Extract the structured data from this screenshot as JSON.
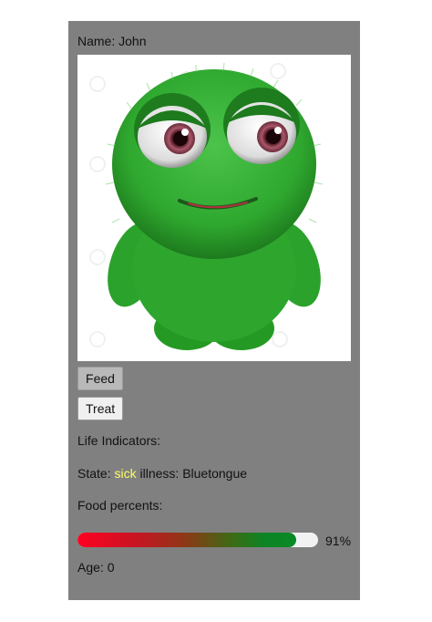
{
  "pet": {
    "name_label": "Name:",
    "name": "John",
    "image_alt": "green furry monster"
  },
  "actions": {
    "feed_label": "Feed",
    "treat_label": "Treat"
  },
  "life": {
    "indicators_label": "Life Indicators:",
    "state_label": "State:",
    "state_value": "sick",
    "illness_label": "illness:",
    "illness_value": "Bluetongue",
    "state_value_color": "#ffff66"
  },
  "food": {
    "label": "Food percents:",
    "percent": 91,
    "percent_text": "91%"
  },
  "age": {
    "label": "Age:",
    "value": "0"
  },
  "colors": {
    "card_background": "#808080",
    "page_background": "#ffffff",
    "monster_green": "#2fa82f"
  }
}
